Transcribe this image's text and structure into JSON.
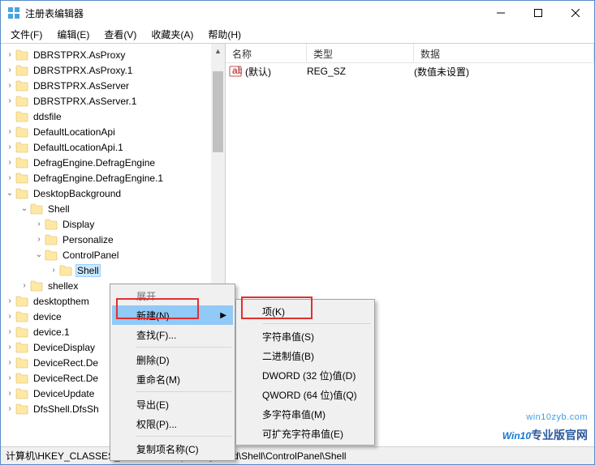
{
  "window": {
    "title": "注册表编辑器"
  },
  "menubar": [
    "文件(F)",
    "编辑(E)",
    "查看(V)",
    "收藏夹(A)",
    "帮助(H)"
  ],
  "tree": [
    {
      "indent": 0,
      "expander": "›",
      "label": "DBRSTPRX.AsProxy"
    },
    {
      "indent": 0,
      "expander": "›",
      "label": "DBRSTPRX.AsProxy.1"
    },
    {
      "indent": 0,
      "expander": "›",
      "label": "DBRSTPRX.AsServer"
    },
    {
      "indent": 0,
      "expander": "›",
      "label": "DBRSTPRX.AsServer.1"
    },
    {
      "indent": 0,
      "expander": "",
      "label": "ddsfile"
    },
    {
      "indent": 0,
      "expander": "›",
      "label": "DefaultLocationApi"
    },
    {
      "indent": 0,
      "expander": "›",
      "label": "DefaultLocationApi.1"
    },
    {
      "indent": 0,
      "expander": "›",
      "label": "DefragEngine.DefragEngine"
    },
    {
      "indent": 0,
      "expander": "›",
      "label": "DefragEngine.DefragEngine.1"
    },
    {
      "indent": 0,
      "expander": "⌄",
      "label": "DesktopBackground"
    },
    {
      "indent": 1,
      "expander": "⌄",
      "label": "Shell"
    },
    {
      "indent": 2,
      "expander": "›",
      "label": "Display"
    },
    {
      "indent": 2,
      "expander": "›",
      "label": "Personalize"
    },
    {
      "indent": 2,
      "expander": "⌄",
      "label": "ControlPanel"
    },
    {
      "indent": 3,
      "expander": "›",
      "label": "Shell",
      "selected": true
    },
    {
      "indent": 1,
      "expander": "›",
      "label": "shellex"
    },
    {
      "indent": 0,
      "expander": "›",
      "label": "desktopthem"
    },
    {
      "indent": 0,
      "expander": "›",
      "label": "device"
    },
    {
      "indent": 0,
      "expander": "›",
      "label": "device.1"
    },
    {
      "indent": 0,
      "expander": "›",
      "label": "DeviceDisplay"
    },
    {
      "indent": 0,
      "expander": "›",
      "label": "DeviceRect.De"
    },
    {
      "indent": 0,
      "expander": "›",
      "label": "DeviceRect.De"
    },
    {
      "indent": 0,
      "expander": "›",
      "label": "DeviceUpdate"
    },
    {
      "indent": 0,
      "expander": "›",
      "label": "DfsShell.DfsSh"
    }
  ],
  "list": {
    "headers": {
      "name": "名称",
      "type": "类型",
      "data": "数据"
    },
    "row": {
      "name": "(默认)",
      "type": "REG_SZ",
      "data": "(数值未设置)"
    }
  },
  "context1": {
    "expand": "展开",
    "new": "新建(N)",
    "find": "查找(F)...",
    "delete": "删除(D)",
    "rename": "重命名(M)",
    "export": "导出(E)",
    "perms": "权限(P)...",
    "copykey": "复制项名称(C)"
  },
  "context2": {
    "key": "项(K)",
    "string": "字符串值(S)",
    "binary": "二进制值(B)",
    "dword": "DWORD (32 位)值(D)",
    "qword": "QWORD (64 位)值(Q)",
    "multi": "多字符串值(M)",
    "expand": "可扩充字符串值(E)"
  },
  "statusbar": "计算机\\HKEY_CLASSES_ROOT\\DesktopBackground\\Shell\\ControlPanel\\Shell",
  "watermark": {
    "url": "win10zyb.com",
    "brand": "Win10",
    "suffix": "专业版官网"
  }
}
